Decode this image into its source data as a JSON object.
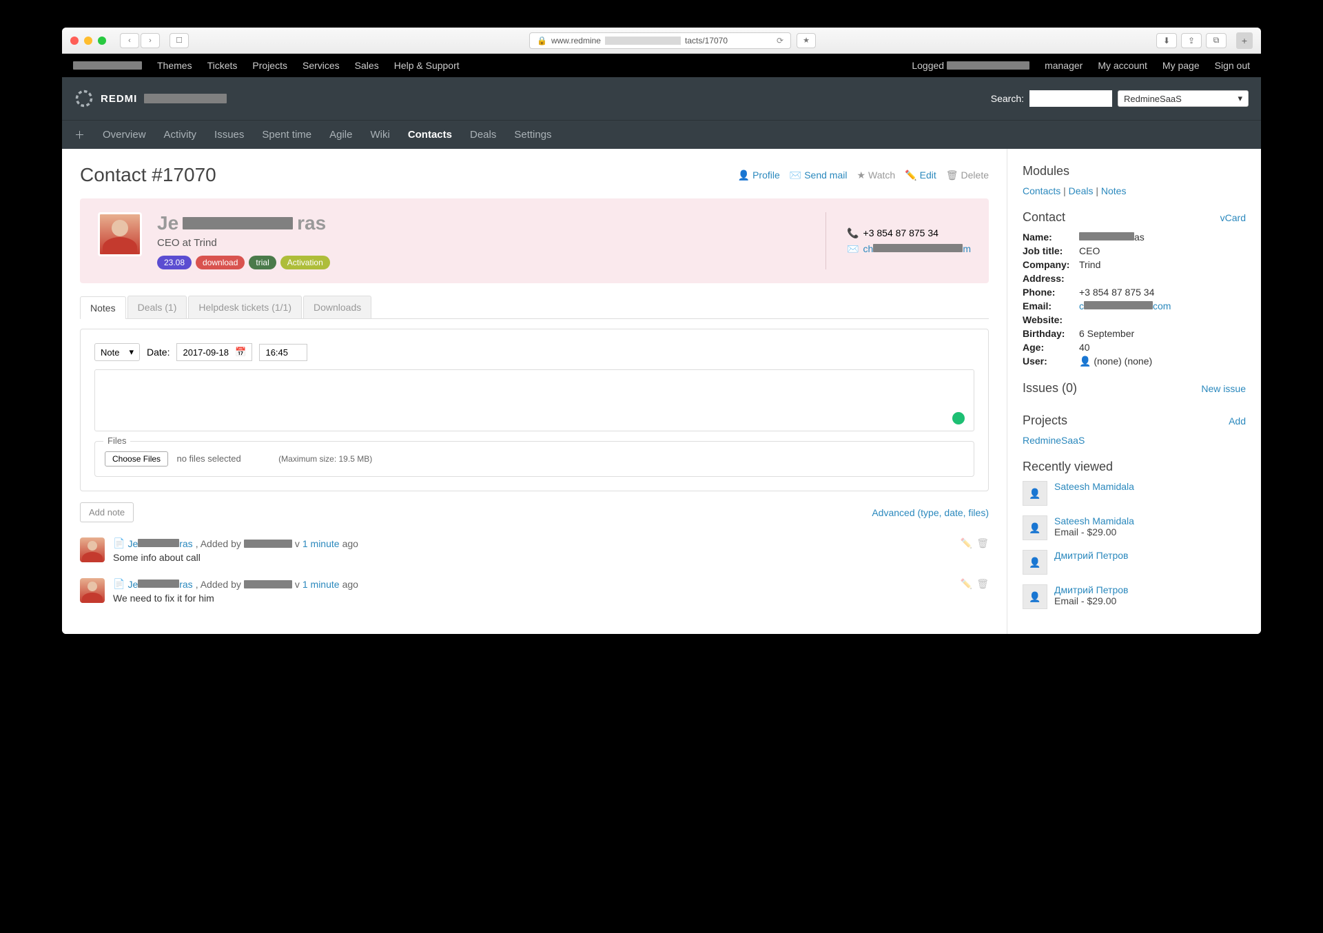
{
  "browser": {
    "url_prefix": "www.redmine",
    "url_suffix": "tacts/17070"
  },
  "topmenu": {
    "left": [
      "Themes",
      "Tickets",
      "Projects",
      "Services",
      "Sales",
      "Help & Support"
    ],
    "logged": "Logged",
    "right": [
      "manager",
      "My account",
      "My page",
      "Sign out"
    ]
  },
  "header": {
    "brand": "REDMI",
    "search_label": "Search:",
    "project": "RedmineSaaS"
  },
  "mainmenu": [
    "Overview",
    "Activity",
    "Issues",
    "Spent time",
    "Agile",
    "Wiki",
    "Contacts",
    "Deals",
    "Settings"
  ],
  "page": {
    "title": "Contact #17070",
    "actions": {
      "profile": "Profile",
      "sendmail": "Send mail",
      "watch": "Watch",
      "edit": "Edit",
      "delete": "Delete"
    }
  },
  "contact": {
    "name_prefix": "Je",
    "name_redacted_suffix": "ras",
    "job": "CEO at Trind",
    "tags": [
      "23.08",
      "download",
      "trial",
      "Activation"
    ],
    "phone": "+3 854 87 875 34",
    "email_prefix": "ch",
    "email_suffix": "m"
  },
  "tabs": [
    "Notes",
    "Deals (1)",
    "Helpdesk tickets (1/1)",
    "Downloads"
  ],
  "noteform": {
    "type": "Note",
    "date_label": "Date:",
    "date": "2017-09-18",
    "time": "16:45",
    "files_legend": "Files",
    "choose": "Choose Files",
    "nofiles": "no files selected",
    "max": "(Maximum size: 19.5 MB)",
    "addbtn": "Add note",
    "advanced": "Advanced (type, date, files)"
  },
  "notes": [
    {
      "author_prefix": "Je",
      "author_suffix": "ras",
      "added": ", Added by",
      "by_suffix": "v",
      "time": "1 minute",
      "ago": "ago",
      "text": "Some info about call"
    },
    {
      "author_prefix": "Je",
      "author_suffix": "ras",
      "added": ", Added by",
      "by_suffix": "v",
      "time": "1 minute",
      "ago": "ago",
      "text": "We need to fix it for him"
    }
  ],
  "sidebar": {
    "modules_h": "Modules",
    "modules": [
      "Contacts",
      "Deals",
      "Notes"
    ],
    "contact_h": "Contact",
    "vcard": "vCard",
    "fields": {
      "Name:": {
        "v": "as",
        "redact": true
      },
      "Job title:": {
        "v": "CEO"
      },
      "Company:": {
        "v": "Trind"
      },
      "Address:": {
        "v": ""
      },
      "Phone:": {
        "v": "+3 854 87 875 34"
      },
      "Email:": {
        "v": "com",
        "prefix": "c",
        "redact": true,
        "link": true
      },
      "Website:": {
        "v": ""
      },
      "Birthday:": {
        "v": "6 September"
      },
      "Age:": {
        "v": "40"
      },
      "User:": {
        "v": "(none) (none)",
        "icon": true
      }
    },
    "issues_h": "Issues (0)",
    "newissue": "New issue",
    "projects_h": "Projects",
    "add": "Add",
    "project": "RedmineSaaS",
    "recent_h": "Recently viewed",
    "recent": [
      {
        "name": "Sateesh Mamidala",
        "sub": ""
      },
      {
        "name": "Sateesh Mamidala",
        "sub": "Email - $29.00"
      },
      {
        "name": "Дмитрий Петров",
        "sub": ""
      },
      {
        "name": "Дмитрий Петров",
        "sub": "Email - $29.00"
      }
    ]
  }
}
